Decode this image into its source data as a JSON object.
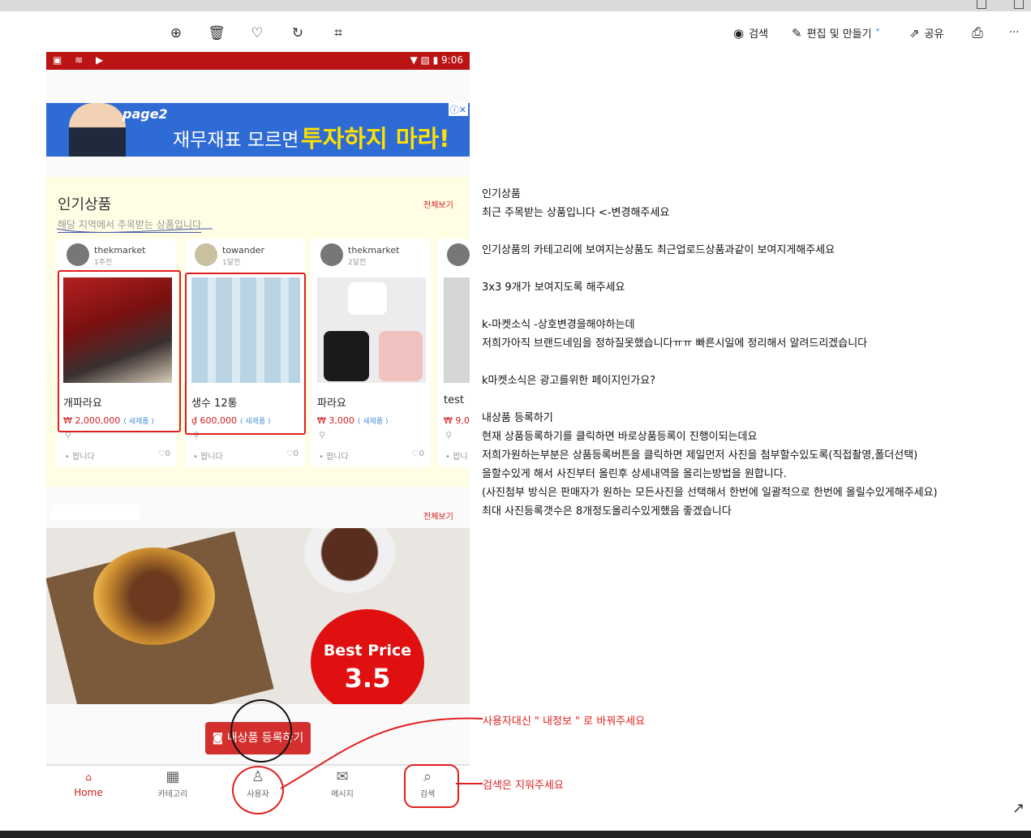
{
  "viewer": {
    "toolbar": {
      "zoom_icon": "zoom-in-icon",
      "delete_icon": "trash-icon",
      "favorite_icon": "heart-icon",
      "rotate_icon": "rotate-icon",
      "crop_icon": "crop-icon",
      "search_label": "검색",
      "edit_label": "편집 및 만들기",
      "share_label": "공유",
      "more_label": "···"
    },
    "accent_color": "#1a73e8"
  },
  "phone": {
    "status": {
      "icons": "▣ ≋ ▶",
      "right": "▼ ▧ ▮ 9:06",
      "bar_color": "#bb1414"
    },
    "ad": {
      "brand": "page2",
      "text_white": "재무재표 모르면",
      "text_yellow": "투자하지 마라!",
      "close": "ⓘ✕"
    },
    "popular": {
      "title": "인기상품",
      "subtitle": "해당 지역에서 주목받는 상품입니다",
      "see_all": "전체보기",
      "cards": [
        {
          "user": "thekmarket",
          "ago": "1주전",
          "name": "개파라요",
          "price": "₩ 2,000,000",
          "condition": "( 새제품 )",
          "status": "팝니다",
          "likes": "♡0"
        },
        {
          "user": "towander",
          "ago": "1달전",
          "name": "생수 12통",
          "price": "₫ 600,000",
          "condition": "( 새제품 )",
          "status": "팝니다",
          "likes": "♡0"
        },
        {
          "user": "thekmarket",
          "ago": "2달전",
          "name": "파라요",
          "price": "₩ 3,000",
          "condition": "( 새제품 )",
          "status": "팝니다",
          "likes": "♡0"
        },
        {
          "user": "",
          "ago": "",
          "name": "test",
          "price": "₩ 9,0",
          "condition": "",
          "status": "팝니",
          "likes": ""
        }
      ]
    },
    "section2": {
      "see_all": "전체보기"
    },
    "banner": {
      "line1": "Best Price",
      "line2": "3.5"
    },
    "register_button": "내상품 등록하기",
    "nav": [
      {
        "label": "Home",
        "icon": "home-icon",
        "glyph": "⌂"
      },
      {
        "label": "카테고리",
        "icon": "grid-icon",
        "glyph": "▦"
      },
      {
        "label": "사용자",
        "icon": "user-icon",
        "glyph": "♙"
      },
      {
        "label": "메시지",
        "icon": "mail-icon",
        "glyph": "✉"
      },
      {
        "label": "검색",
        "icon": "search-icon",
        "glyph": "⌕"
      }
    ]
  },
  "notes": [
    "인기상품",
    "최근 주목받는 상품입니다 <-변경해주세요",
    "",
    "인기상품의 카테고리에 보여지는상품도 최근업로드상품과같이 보여지게해주세요",
    "",
    "3x3 9개가 보여지도록 해주세요",
    "",
    "k-마켓소식 -상호변경을해야하는데",
    "저희가아직 브랜드네임을 정하질못했습니다ㅠㅠ 빠른시일에 정리해서 알려드리겠습니다",
    "",
    "k마켓소식은 광고를위한 페이지인가요?",
    "",
    " 내상품 등록하기",
    " 현재 상품등록하기를 클릭하면 바로상품등록이 진행이되는데요",
    " 저희가원하는부분은 상품등록버튼을 클릭하면 제일먼저 사진을 첨부할수있도록(직접촬영,폴더선택)",
    " 을할수있게 해서 사진부터 올린후 상세내역을 올리는방법을 원합니다.",
    " (사진첨부 방식은 판매자가 원하는 모든사진을 선택해서 한번에 일괄적으로 한번에 올릴수있게해주세요)",
    " 최대 사진등록갯수은 8개정도올리수있게했음 좋겠습니다"
  ],
  "red_notes": {
    "user_note": "사용자대신 \" 내정보 \" 로 바꿔주세요",
    "search_note": "검색은 지워주세요"
  },
  "annotation_color": "#e02020",
  "expand_icon": "↗"
}
